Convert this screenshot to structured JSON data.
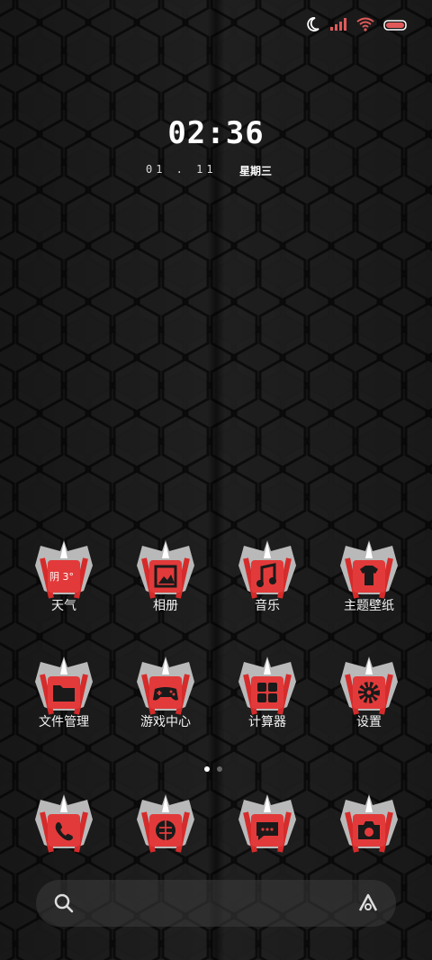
{
  "status": {
    "icons": [
      "moon-icon",
      "signal-icon",
      "wifi-icon",
      "battery-icon"
    ],
    "accent": "#e05a5a"
  },
  "clock": {
    "time": "02:36",
    "date": "01 . 11",
    "weekday": "星期三"
  },
  "apps": [
    {
      "label": "天气",
      "badge": "阴 3°",
      "glyph": "weather"
    },
    {
      "label": "相册",
      "glyph": "gallery"
    },
    {
      "label": "音乐",
      "glyph": "music"
    },
    {
      "label": "主题壁纸",
      "glyph": "theme"
    },
    {
      "label": "文件管理",
      "glyph": "folder"
    },
    {
      "label": "游戏中心",
      "glyph": "game"
    },
    {
      "label": "计算器",
      "glyph": "calculator"
    },
    {
      "label": "设置",
      "glyph": "settings"
    }
  ],
  "dock": [
    {
      "glyph": "phone"
    },
    {
      "glyph": "browser"
    },
    {
      "glyph": "messages"
    },
    {
      "glyph": "camera"
    }
  ],
  "pager": {
    "pages": 2,
    "current": 1
  },
  "colors": {
    "red": "#e23a3a",
    "silver": "#c8c8c8",
    "dark": "#1a1a1a"
  }
}
